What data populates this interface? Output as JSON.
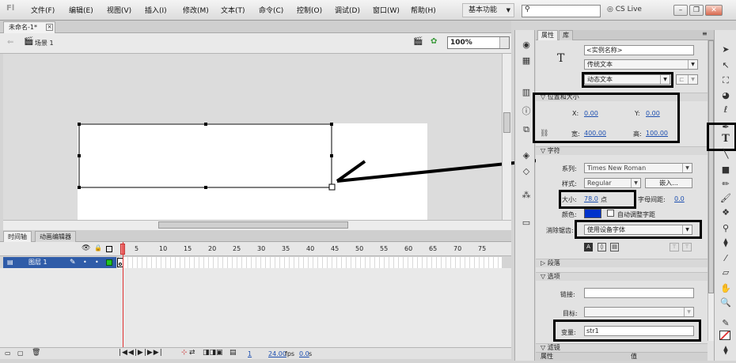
{
  "app": {
    "logo": "Fl",
    "workspace": "基本功能",
    "cslive": "CS Live"
  },
  "menu": [
    "文件(F)",
    "编辑(E)",
    "视图(V)",
    "插入(I)",
    "修改(M)",
    "文本(T)",
    "命令(C)",
    "控制(O)",
    "调试(D)",
    "窗口(W)",
    "帮助(H)"
  ],
  "document": {
    "tab": "未命名-1*",
    "scene": "场景 1",
    "zoom": "100%"
  },
  "timeline": {
    "tabs": [
      "时间轴",
      "动画编辑器"
    ],
    "layer": "图层 1",
    "frame_numbers": [
      "5",
      "10",
      "15",
      "20",
      "25",
      "30",
      "35",
      "40",
      "45",
      "50",
      "55",
      "60",
      "65",
      "70",
      "75"
    ],
    "status": {
      "frame": "1",
      "fps": "24.00",
      "fps_unit": "fps",
      "time": "0.0",
      "time_unit": "s"
    }
  },
  "properties": {
    "tabs": [
      "属性",
      "库"
    ],
    "instance_name_placeholder": "<实例名称>",
    "text_engine": "传统文本",
    "text_type": "动态文本",
    "position_size": {
      "header": "位置和大小",
      "x_label": "X:",
      "x": "0.00",
      "y_label": "Y:",
      "y": "0.00",
      "w_label": "宽:",
      "w": "400.00",
      "h_label": "高:",
      "h": "100.00"
    },
    "character": {
      "header": "字符",
      "family_label": "系列:",
      "family": "Times New Roman",
      "style_label": "样式:",
      "style": "Regular",
      "embed_button": "嵌入...",
      "size_label": "大小:",
      "size": "78.0",
      "size_unit": "点",
      "spacing_label": "字母间距:",
      "spacing": "0.0",
      "color_label": "颜色:",
      "color": "#0033cc",
      "autokern_label": "自动调整字距",
      "antialias_label": "消除锯齿:",
      "antialias": "使用设备字体"
    },
    "paragraph": {
      "header": "段落"
    },
    "options": {
      "header": "选项",
      "link_label": "链接:",
      "link": "",
      "target_label": "目标:",
      "target": "",
      "var_label": "变量:",
      "var": "str1"
    },
    "filters": {
      "header": "滤镜",
      "col1": "属性",
      "col2": "值"
    }
  },
  "colors": {
    "highlight": "#000000",
    "selection": "#2f5ca8",
    "playhead": "#e03030",
    "layer_square": "#22c422"
  }
}
